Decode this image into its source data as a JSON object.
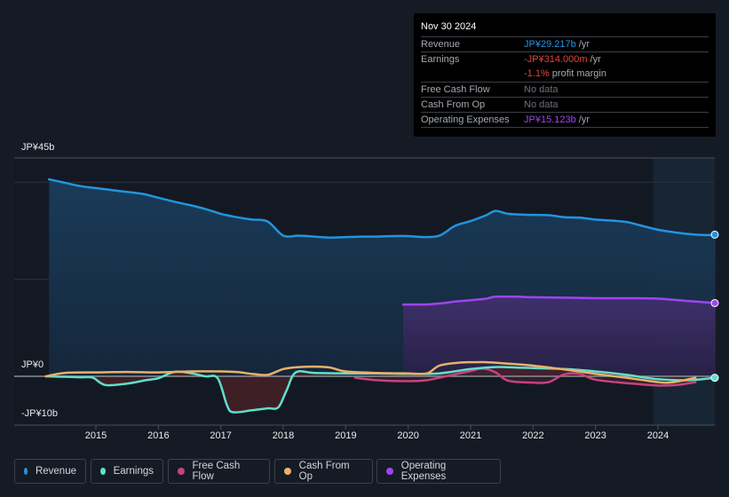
{
  "tooltip": {
    "date": "Nov 30 2024",
    "rows": [
      {
        "label": "Revenue",
        "value": "JP¥29.217b",
        "suffix": " /yr",
        "color": "#2394df"
      },
      {
        "label": "Earnings",
        "value": "-JP¥314.000m",
        "suffix": " /yr",
        "color": "#e64141"
      },
      {
        "label": "",
        "value": "-1.1%",
        "suffix": " profit margin",
        "color": "#e64141"
      },
      {
        "label": "Free Cash Flow",
        "value": "No data",
        "suffix": "",
        "color": "#6c7178"
      },
      {
        "label": "Cash From Op",
        "value": "No data",
        "suffix": "",
        "color": "#6c7178"
      },
      {
        "label": "Operating Expenses",
        "value": "JP¥15.123b",
        "suffix": " /yr",
        "color": "#a044f0"
      }
    ]
  },
  "legend": [
    {
      "label": "Revenue",
      "color": "#2394df"
    },
    {
      "label": "Earnings",
      "color": "#5ee0cd"
    },
    {
      "label": "Free Cash Flow",
      "color": "#c9417f"
    },
    {
      "label": "Cash From Op",
      "color": "#e9b06a"
    },
    {
      "label": "Operating Expenses",
      "color": "#a044f0"
    }
  ],
  "chart_data": {
    "type": "area",
    "title": "",
    "xlabel": "",
    "ylabel": "",
    "unit": "JP¥ billions",
    "ylim": [
      -10,
      45
    ],
    "xlim": [
      2014.2,
      2024.92
    ],
    "y_tick_labels": [
      {
        "value": 45,
        "label": "JP¥45b"
      },
      {
        "value": 0,
        "label": "JP¥0"
      },
      {
        "value": -10,
        "label": "-JP¥10b"
      }
    ],
    "gridlines": [
      40,
      20,
      0
    ],
    "x_tick_labels": [
      "2015",
      "2016",
      "2017",
      "2018",
      "2019",
      "2020",
      "2021",
      "2022",
      "2023",
      "2024"
    ],
    "x_ticks": [
      2015,
      2016,
      2017,
      2018,
      2019,
      2020,
      2021,
      2022,
      2023,
      2024
    ],
    "highlight_start": 2023.92,
    "series": [
      {
        "name": "Revenue",
        "color": "#2394df",
        "fill": "#1a3a57",
        "x": [
          2014.25,
          2014.5,
          2014.75,
          2015.0,
          2015.25,
          2015.5,
          2015.75,
          2016.0,
          2016.25,
          2016.5,
          2016.75,
          2017.0,
          2017.25,
          2017.5,
          2017.75,
          2018.0,
          2018.25,
          2018.5,
          2018.75,
          2019.0,
          2019.25,
          2019.5,
          2019.75,
          2020.0,
          2020.25,
          2020.5,
          2020.75,
          2021.0,
          2021.25,
          2021.4,
          2021.6,
          2021.9,
          2022.25,
          2022.5,
          2022.75,
          2023.0,
          2023.25,
          2023.5,
          2023.75,
          2024.0,
          2024.25,
          2024.5,
          2024.75,
          2024.92
        ],
        "values": [
          40.6,
          39.9,
          39.2,
          38.8,
          38.4,
          38.0,
          37.6,
          36.8,
          36.0,
          35.3,
          34.5,
          33.5,
          32.8,
          32.3,
          31.9,
          29.0,
          29.0,
          28.8,
          28.6,
          28.7,
          28.8,
          28.8,
          28.9,
          28.9,
          28.7,
          29.0,
          31.0,
          32.0,
          33.2,
          34.1,
          33.5,
          33.3,
          33.2,
          32.8,
          32.7,
          32.3,
          32.1,
          31.8,
          31.0,
          30.2,
          29.7,
          29.3,
          29.1,
          29.2
        ]
      },
      {
        "name": "Operating Expenses",
        "color": "#a044f0",
        "fill": "#3b2d68",
        "x": [
          2019.92,
          2020.25,
          2020.5,
          2020.75,
          2021.0,
          2021.25,
          2021.4,
          2021.75,
          2022.0,
          2022.5,
          2023.0,
          2023.5,
          2024.0,
          2024.5,
          2024.92
        ],
        "values": [
          14.8,
          14.8,
          15.0,
          15.4,
          15.7,
          16.0,
          16.4,
          16.4,
          16.3,
          16.2,
          16.1,
          16.1,
          16.0,
          15.5,
          15.1
        ]
      },
      {
        "name": "Earnings",
        "color": "#5ee0cd",
        "x": [
          2014.2,
          2014.5,
          2014.75,
          2014.95,
          2015.15,
          2015.5,
          2015.8,
          2016.0,
          2016.25,
          2016.5,
          2016.75,
          2016.95,
          2017.1,
          2017.2,
          2017.5,
          2017.75,
          2017.92,
          2018.05,
          2018.2,
          2018.5,
          2019.0,
          2019.5,
          2020.0,
          2020.5,
          2021.0,
          2021.4,
          2021.75,
          2022.0,
          2022.5,
          2023.0,
          2023.5,
          2024.0,
          2024.5,
          2024.92
        ],
        "values": [
          0.0,
          -0.1,
          -0.2,
          -0.3,
          -1.8,
          -1.5,
          -0.8,
          -0.4,
          0.9,
          0.7,
          0.0,
          -0.4,
          -6.0,
          -7.4,
          -7.0,
          -6.6,
          -6.4,
          -3.0,
          0.8,
          0.7,
          0.6,
          0.6,
          0.5,
          0.6,
          1.5,
          1.9,
          1.8,
          1.7,
          1.5,
          1.0,
          0.3,
          -0.6,
          -0.8,
          -0.3
        ]
      },
      {
        "name": "Cash From Op",
        "color": "#e9b06a",
        "x": [
          2014.2,
          2014.5,
          2015.0,
          2015.5,
          2016.0,
          2016.5,
          2017.0,
          2017.25,
          2017.5,
          2017.75,
          2018.0,
          2018.25,
          2018.5,
          2018.75,
          2019.0,
          2019.5,
          2020.0,
          2020.3,
          2020.5,
          2020.8,
          2021.0,
          2021.25,
          2021.5,
          2022.0,
          2022.5,
          2023.0,
          2023.5,
          2024.0,
          2024.25,
          2024.6
        ],
        "values": [
          0.0,
          0.7,
          0.8,
          0.9,
          0.8,
          1.0,
          1.0,
          0.9,
          0.5,
          0.3,
          1.5,
          1.9,
          2.0,
          1.8,
          1.0,
          0.7,
          0.6,
          0.6,
          2.2,
          2.8,
          2.9,
          2.9,
          2.7,
          2.2,
          1.4,
          0.5,
          -0.3,
          -1.2,
          -1.2,
          -0.3
        ]
      },
      {
        "name": "Free Cash Flow",
        "color": "#c9417f",
        "fill": "#4a2027",
        "x": [
          2019.15,
          2019.5,
          2020.0,
          2020.3,
          2020.6,
          2021.0,
          2021.2,
          2021.4,
          2021.6,
          2022.0,
          2022.25,
          2022.5,
          2022.75,
          2023.0,
          2023.5,
          2024.0,
          2024.3,
          2024.6
        ],
        "values": [
          -0.3,
          -0.8,
          -1.0,
          -0.8,
          0.0,
          1.1,
          1.6,
          0.8,
          -0.9,
          -1.3,
          -1.2,
          0.4,
          0.5,
          -0.7,
          -1.4,
          -1.9,
          -1.8,
          -1.2
        ]
      }
    ],
    "end_markers": [
      "Revenue",
      "Operating Expenses",
      "Earnings"
    ]
  }
}
